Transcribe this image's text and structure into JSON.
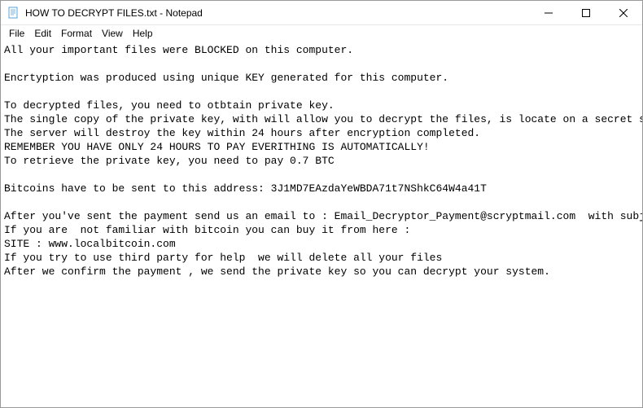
{
  "titlebar": {
    "title": "HOW TO DECRYPT FILES.txt - Notepad"
  },
  "menubar": {
    "file": "File",
    "edit": "Edit",
    "format": "Format",
    "view": "View",
    "help": "Help"
  },
  "content": {
    "line1": "All your important files were BLOCKED on this computer.",
    "line2": "",
    "line3": "Encrtyption was produced using unique KEY generated for this computer.",
    "line4": "",
    "line5": "To decrypted files, you need to otbtain private key.",
    "line6": "The single copy of the private key, with will allow you to decrypt the files, is locate on a secret serve",
    "line7": "The server will destroy the key within 24 hours after encryption completed.",
    "line8": "REMEMBER YOU HAVE ONLY 24 HOURS TO PAY EVERITHING IS AUTOMATICALLY!",
    "line9": "To retrieve the private key, you need to pay 0.7 BTC",
    "line10": "",
    "line11": "Bitcoins have to be sent to this address: 3J1MD7EAzdaYeWBDA71t7NShkC64W4a41T",
    "line12": "",
    "line13": "After you've sent the payment send us an email to : Email_Decryptor_Payment@scryptmail.com  with subject ",
    "line14": "If you are  not familiar with bitcoin you can buy it from here :",
    "line15": "SITE : www.localbitcoin.com",
    "line16": "If you try to use third party for help  we will delete all your files",
    "line17": "After we confirm the payment , we send the private key so you can decrypt your system."
  }
}
